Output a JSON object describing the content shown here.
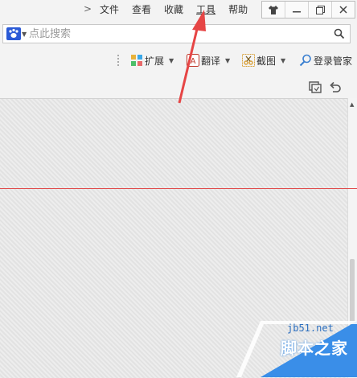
{
  "menubar": {
    "items": [
      {
        "label": "文件"
      },
      {
        "label": "查看"
      },
      {
        "label": "收藏"
      },
      {
        "label": "工具"
      },
      {
        "label": "帮助"
      }
    ],
    "controls": [
      "shirt-icon",
      "minimize-icon",
      "restore-icon",
      "close-icon"
    ]
  },
  "search": {
    "placeholder": "点此搜索",
    "value": ""
  },
  "toolbar": {
    "extend_label": "扩展",
    "translate_label": "翻译",
    "screenshot_label": "截图",
    "login_label": "登录管家"
  },
  "watermark": {
    "url": "jb51.net",
    "name": "脚本之家"
  },
  "colors": {
    "arrow": "#e64545",
    "divider_line": "#e04848",
    "watermark_blue": "#3a8ee8"
  }
}
